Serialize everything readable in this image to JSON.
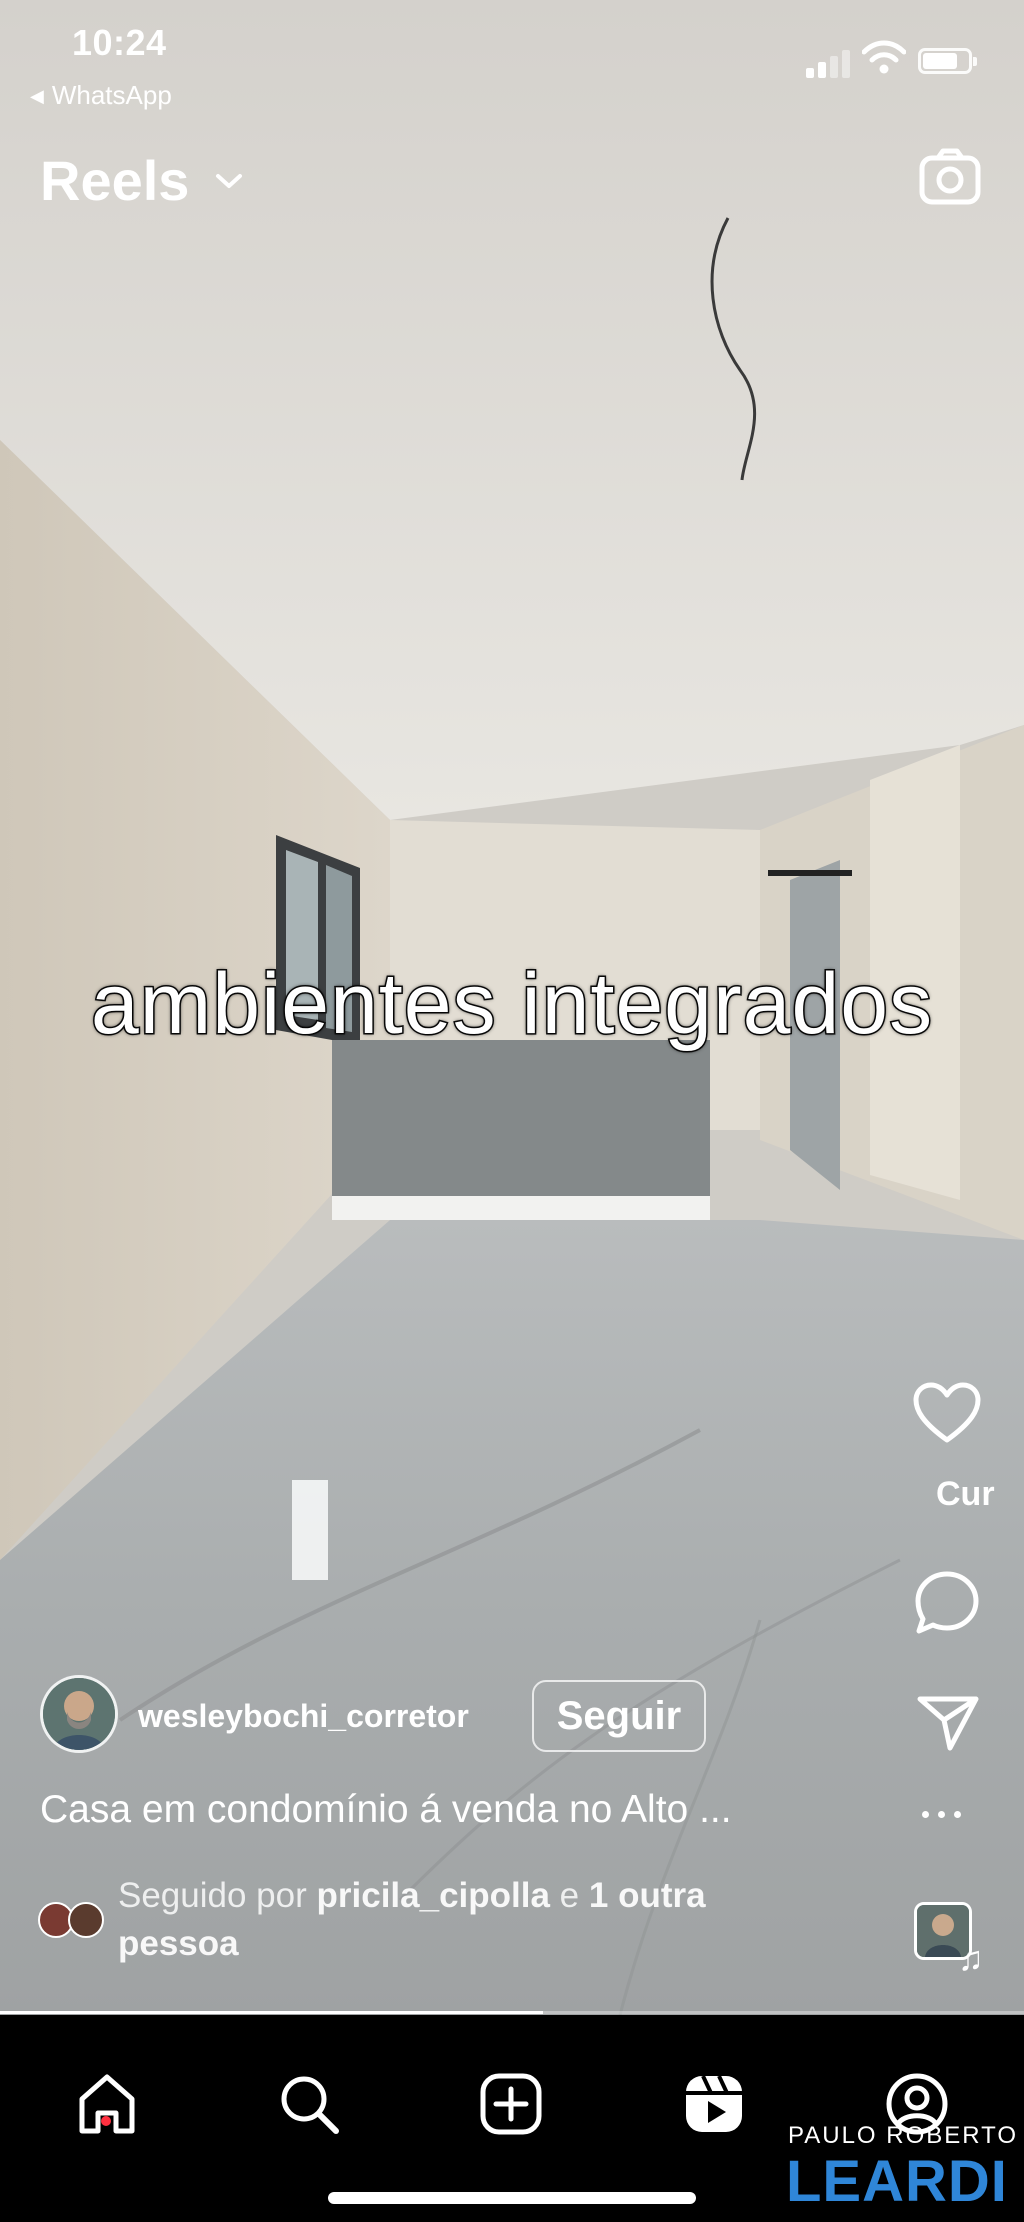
{
  "status_bar": {
    "time": "10:24",
    "back_app": "WhatsApp",
    "back_icon": "back-triangle-icon",
    "signal_icon": "cellular-signal-icon",
    "wifi_icon": "wifi-icon",
    "battery_icon": "battery-icon",
    "battery_level": 0.8
  },
  "header": {
    "title": "Reels",
    "title_menu_icon": "chevron-down-icon",
    "camera_icon": "camera-icon"
  },
  "video": {
    "overlay_text": "ambientes integrados",
    "progress": 0.53
  },
  "actions": {
    "like_icon": "heart-icon",
    "like_count": "Cur",
    "comment_icon": "comment-bubble-icon",
    "share_icon": "paper-plane-icon",
    "more_icon": "more-dots-icon",
    "audio_icon": "music-note-icon"
  },
  "post": {
    "author": "wesleybochi_corretor",
    "follow_label": "Seguir",
    "caption": "Casa em condomínio á venda no Alto ...",
    "followed_prefix": "Seguido por",
    "followed_user": "pricila_cipolla",
    "followed_joiner": "e",
    "followed_others": "1 outra",
    "followed_suffix": "pessoa"
  },
  "bottom_nav": {
    "items": [
      {
        "name": "home",
        "icon": "home-icon",
        "active": true
      },
      {
        "name": "search",
        "icon": "search-icon"
      },
      {
        "name": "create",
        "icon": "add-post-icon"
      },
      {
        "name": "reels",
        "icon": "reels-icon"
      },
      {
        "name": "profile",
        "icon": "profile-icon"
      }
    ]
  },
  "watermark": {
    "top": "PAULO ROBERTO",
    "main": "LEARDI",
    "color": "#2f86d8"
  },
  "colors": {
    "ui_white": "#ffffff",
    "nav_background": "#000000",
    "notification_dot": "#ff3040"
  }
}
